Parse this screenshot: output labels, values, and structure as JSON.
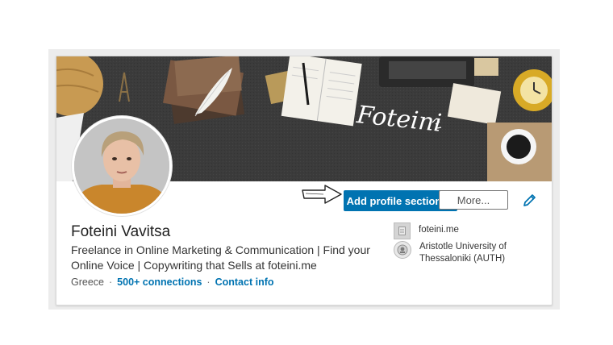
{
  "profile": {
    "name": "Foteini Vavitsa",
    "headline": "Freelance in Online Marketing & Communication | Find your Online Voice | Copywriting that Sells at foteini.me",
    "location": "Greece",
    "separator": "·",
    "connections": "500+ connections",
    "contact_info": "Contact info"
  },
  "banner": {
    "logo_text": "Foteini"
  },
  "actions": {
    "add_section_label": "Add profile section",
    "more_label": "More..."
  },
  "sidebar": {
    "website": "foteini.me",
    "education": "Aristotle University of Thessaloniki (AUTH)"
  },
  "colors": {
    "primary": "#0073b1",
    "banner_bg": "#3a3a3a"
  },
  "icons": [
    "caret-down-icon",
    "pencil-icon",
    "arrow-pointer-icon",
    "website-icon",
    "university-seal-icon"
  ]
}
